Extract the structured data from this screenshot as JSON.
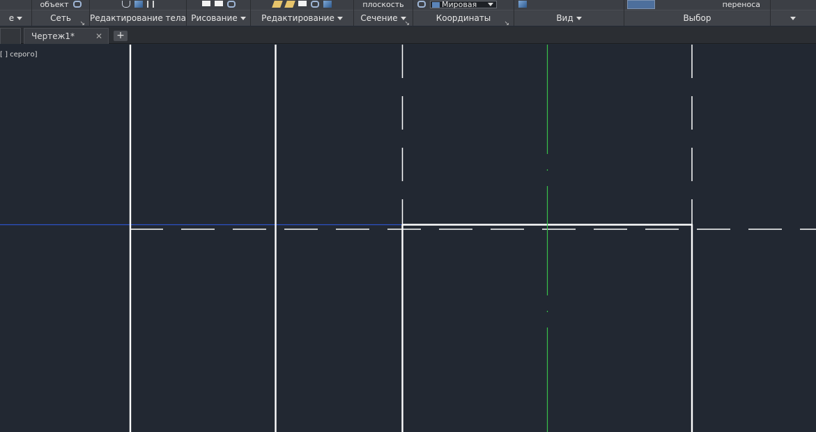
{
  "ribbon": {
    "panels": [
      {
        "title": "е",
        "tools": []
      },
      {
        "title": "Сеть",
        "tools": [
          "объект"
        ]
      },
      {
        "title": "Редактирование тела",
        "tools": []
      },
      {
        "title": "Рисование",
        "tools": []
      },
      {
        "title": "Редактирование",
        "tools": []
      },
      {
        "title": "Сечение",
        "tools": [
          "плоскость"
        ]
      },
      {
        "title": "Координаты",
        "tools": []
      },
      {
        "title": "Вид",
        "tools": []
      },
      {
        "title": "Выбор",
        "tools": [
          "переноса"
        ]
      }
    ],
    "coordinate_system_value": "Мировая"
  },
  "tabs": [
    {
      "label": "Чертеж1*",
      "active": true
    }
  ],
  "canvas": {
    "view_label": "[ ] серого]",
    "background_color": "#222832",
    "line_color": "#ffffff",
    "axis_green": "#39c14a",
    "axis_blue": "#2d52c8"
  }
}
